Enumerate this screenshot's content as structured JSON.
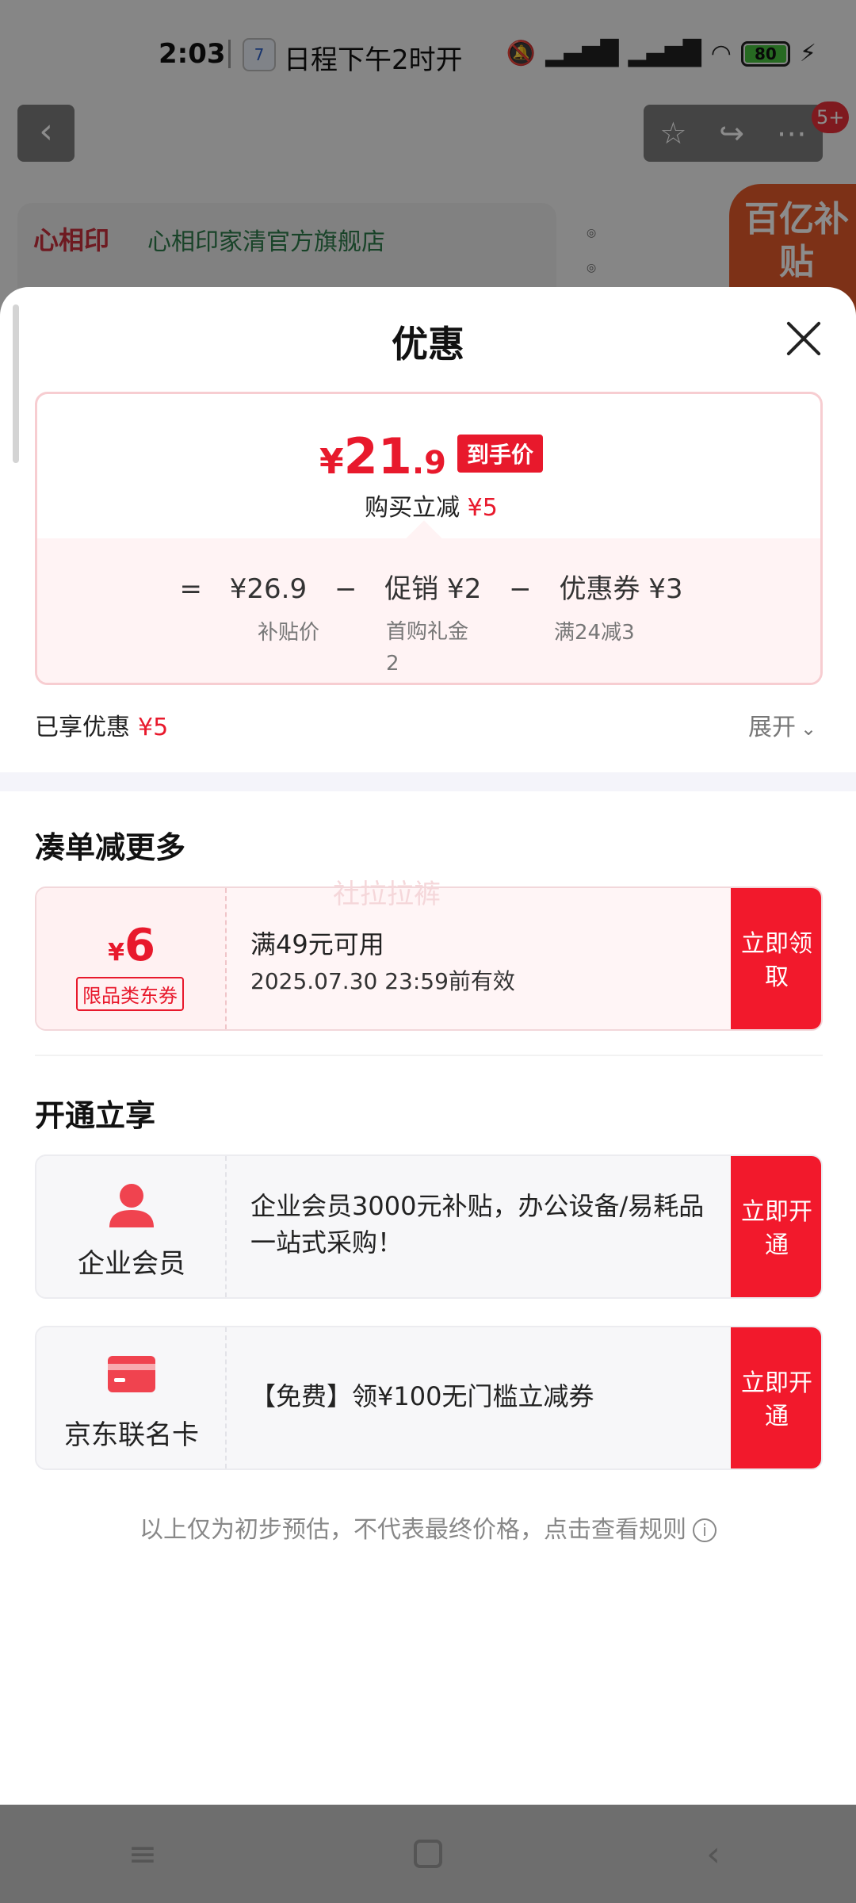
{
  "status_bar": {
    "time": "2:03",
    "calendar_day": "7",
    "notification": "日程下午2时开",
    "battery": "80"
  },
  "top_nav": {
    "badge": "5+"
  },
  "background_page": {
    "store_name": "心相印家清官方旗舰店",
    "store_logo": "心相印",
    "promo_tag": "百亿补贴"
  },
  "sheet": {
    "title": "优惠",
    "price": {
      "currency": "¥",
      "integer": "21",
      "decimal": ".9",
      "tag": "到手价",
      "buy_reduce_label": "购买立减",
      "buy_reduce_value": "¥5"
    },
    "formula": {
      "equals": "=",
      "base_price": "¥26.9",
      "minus1": "−",
      "promo": "促销 ¥2",
      "minus2": "−",
      "coupon": "优惠券 ¥3",
      "base_label": "补贴价",
      "promo_label": "首购礼金2",
      "coupon_label": "满24减3"
    },
    "enjoyed_label": "已享优惠",
    "enjoyed_value": "¥5",
    "expand_label": "展开",
    "more_section_title": "凑单减更多",
    "coupon": {
      "currency": "¥",
      "amount": "6",
      "kind": "限品类东券",
      "condition": "满49元可用",
      "validity": "2025.07.30 23:59前有效",
      "button": "立即领取",
      "watermark": "社拉拉裤"
    },
    "open_section_title": "开通立享",
    "members": [
      {
        "label": "企业会员",
        "icon": "person-icon",
        "desc": "企业会员3000元补贴，办公设备/易耗品一站式采购！",
        "button": "立即开通"
      },
      {
        "label": "京东联名卡",
        "icon": "credit-card-icon",
        "desc": "【免费】领¥100无门槛立减券",
        "button": "立即开通"
      }
    ],
    "disclaimer": "以上仅为初步预估，不代表最终价格，点击查看规则"
  },
  "colors": {
    "accent_red": "#e8192c",
    "button_red": "#f2192c",
    "price_box_border": "#f7cdd1"
  }
}
